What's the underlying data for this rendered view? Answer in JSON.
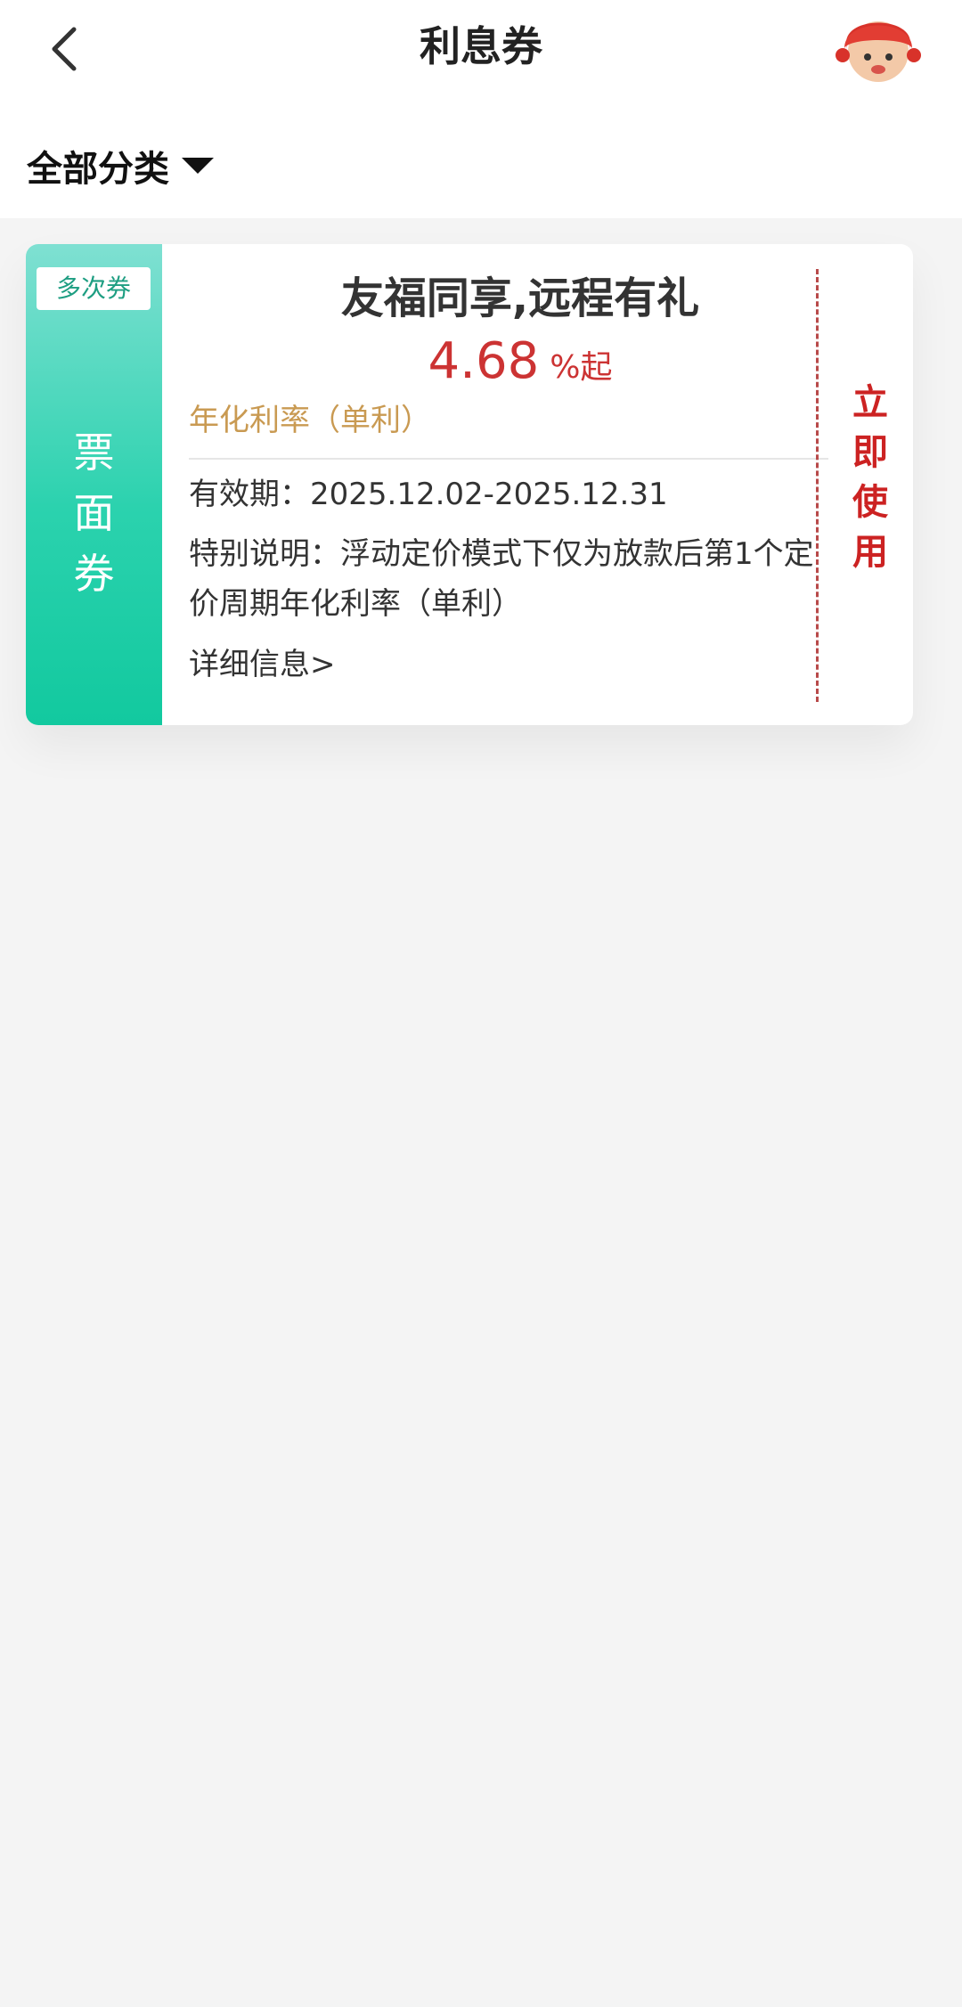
{
  "header": {
    "title": "利息券",
    "back_icon": "chevron-left-icon",
    "avatar_icon": "mascot-avatar-icon"
  },
  "filter": {
    "label": "全部分类",
    "caret_icon": "caret-down-icon"
  },
  "coupon": {
    "tag": "多次券",
    "side_label": [
      "票",
      "面",
      "券"
    ],
    "title": "友福同享,远程有礼",
    "rate_value": "4.68",
    "rate_suffix": "%起",
    "rate_label": "年化利率（单利）",
    "validity": "有效期：2025.12.02-2025.12.31",
    "special_note": "特别说明：浮动定价模式下仅为放款后第1个定价周期年化利率（单利）",
    "detail_link": "详细信息>",
    "action": [
      "立",
      "即",
      "使",
      "用"
    ],
    "colors": {
      "accent_green": "#2bd2ae",
      "rate_red": "#cc3333",
      "label_gold": "#c99a52",
      "action_red": "#cc2222"
    }
  }
}
